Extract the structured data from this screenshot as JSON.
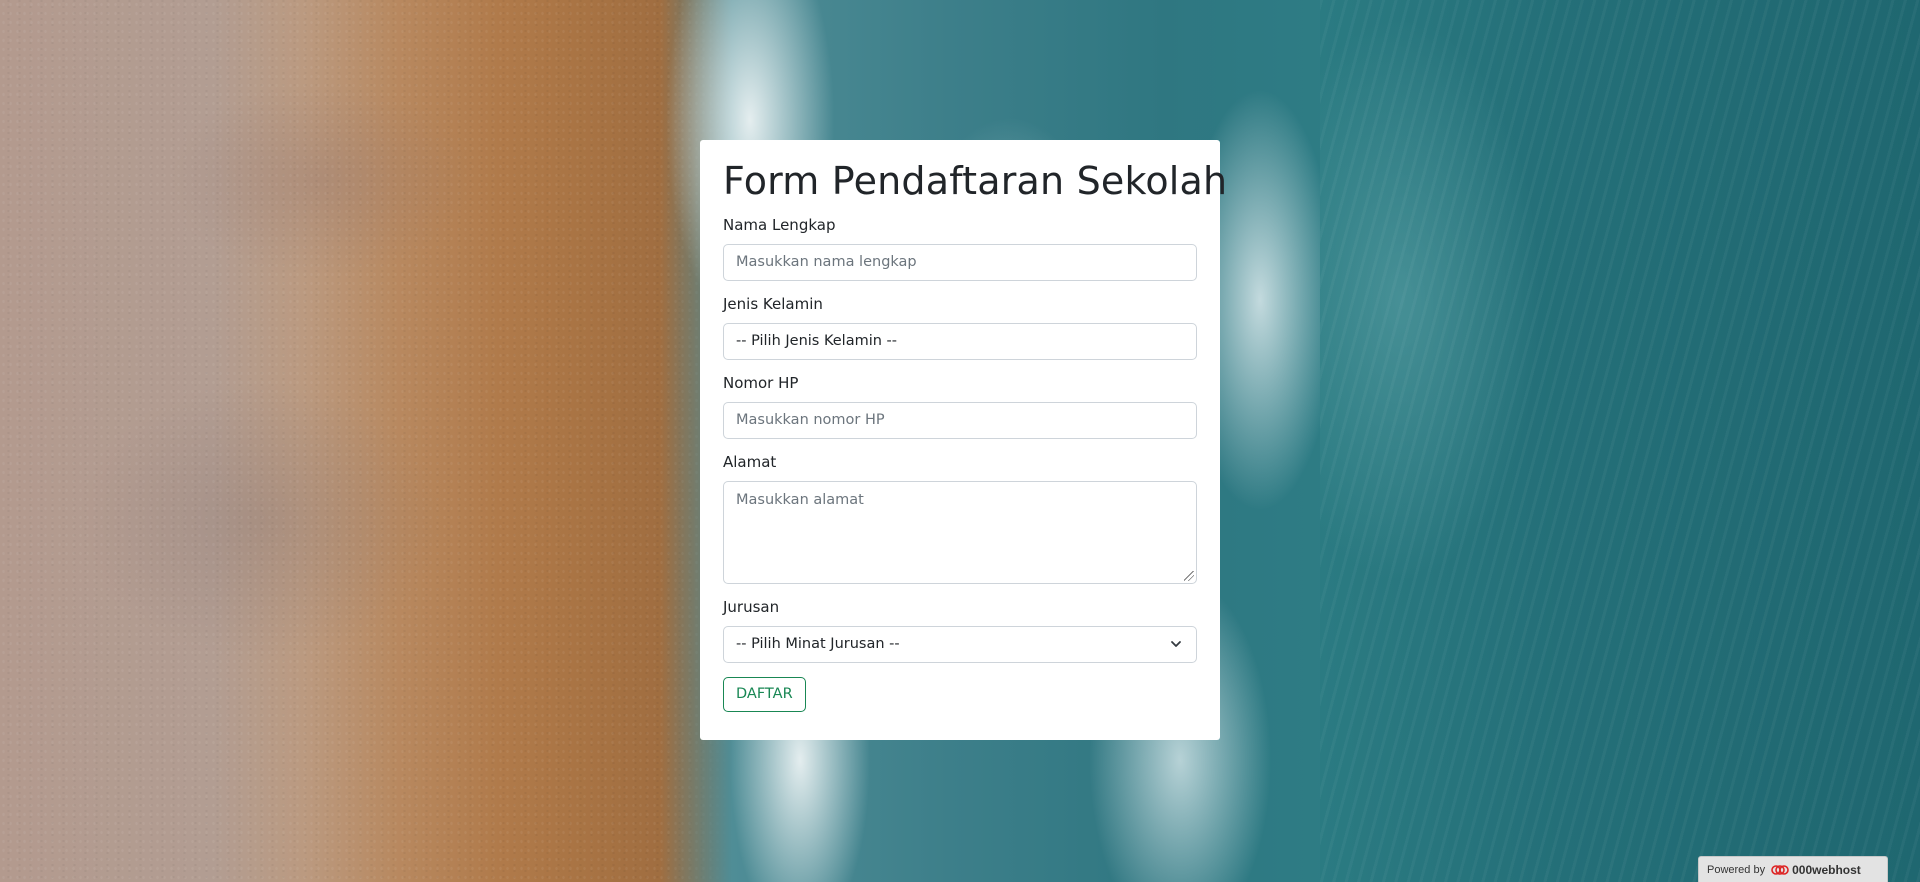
{
  "form": {
    "title": "Form Pendaftaran Sekolah",
    "fields": {
      "nama": {
        "label": "Nama Lengkap",
        "placeholder": "Masukkan nama lengkap"
      },
      "jenis_kelamin": {
        "label": "Jenis Kelamin",
        "selected": "-- Pilih Jenis Kelamin --"
      },
      "nomor_hp": {
        "label": "Nomor HP",
        "placeholder": "Masukkan nomor HP"
      },
      "alamat": {
        "label": "Alamat",
        "placeholder": "Masukkan alamat"
      },
      "jurusan": {
        "label": "Jurusan",
        "selected": "-- Pilih Minat Jurusan --"
      }
    },
    "submit_label": "DAFTAR"
  },
  "badge": {
    "powered_label": "Powered by",
    "brand": "000webhost",
    "logo_icon": "000webhost-logo-icon"
  },
  "colors": {
    "primary_button": "#198754",
    "card_bg": "#ffffff",
    "input_border": "#ced4da"
  }
}
